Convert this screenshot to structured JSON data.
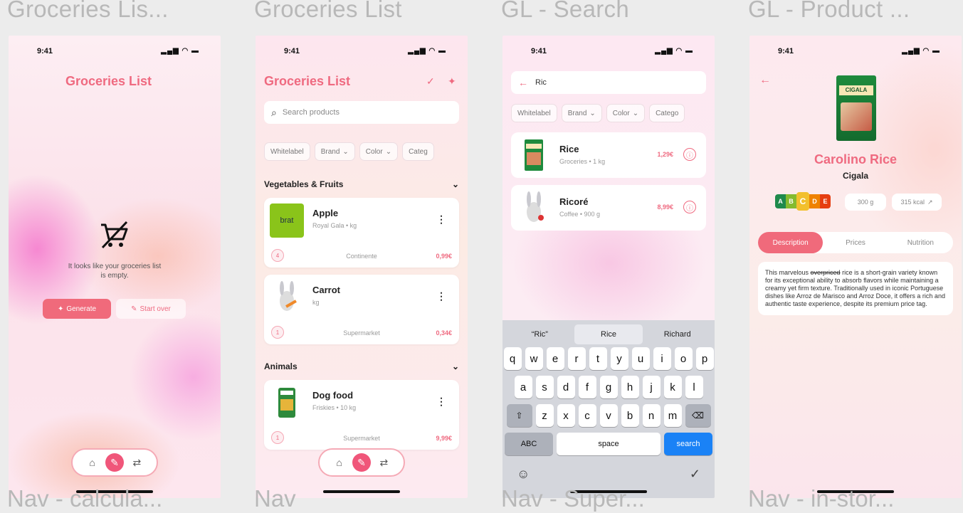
{
  "frame_titles": [
    "Groceries Lis...",
    "Groceries List",
    "GL - Search",
    "GL - Product ..."
  ],
  "frame_bottoms": [
    "Nav - calcula...",
    "Nav",
    "Nav - Super...",
    "Nav - in-stor..."
  ],
  "status": {
    "time": "9:41",
    "icons": "▂▄▆ ◠ ▬"
  },
  "icons": {
    "home": "⌂",
    "list": "✎",
    "swap": "⇄",
    "mic": "✓",
    "sparkle": "✦",
    "search": "⌕",
    "chevron": "⌄",
    "back": "←",
    "more": "⋮",
    "info": "ⓘ",
    "backspace": "⌫",
    "shift": "⇧",
    "emoji": "☺",
    "dictation": "✓",
    "external": "↗"
  },
  "empty_state": {
    "title": "Groceries List",
    "message": "It looks like your groceries list is empty.",
    "generate_label": "Generate",
    "start_over_label": "Start over"
  },
  "list_screen": {
    "title": "Groceries List",
    "search_placeholder": "Search products",
    "filters": [
      "Whitelabel",
      "Brand",
      "Color",
      "Categ"
    ],
    "sections": [
      {
        "title": "Vegetables & Fruits",
        "items": [
          {
            "name": "Apple",
            "sub": "Royal Gala • kg",
            "qty": "4",
            "store": "Continente",
            "price": "0,99€",
            "thumb_text": "brat"
          },
          {
            "name": "Carrot",
            "sub": "kg",
            "qty": "1",
            "store": "Supermarket",
            "price": "0,34€",
            "thumb_text": ""
          }
        ]
      },
      {
        "title": "Animals",
        "items": [
          {
            "name": "Dog food",
            "sub": "Friskies • 10 kg",
            "qty": "1",
            "store": "Supermarket",
            "price": "9,99€",
            "thumb_text": ""
          }
        ]
      }
    ]
  },
  "search_screen": {
    "query": "Ric",
    "filters": [
      "Whitelabel",
      "Brand",
      "Color",
      "Catego"
    ],
    "results": [
      {
        "name": "Rice",
        "sub": "Groceries • 1 kg",
        "price": "1,29€"
      },
      {
        "name": "Ricoré",
        "sub": "Coffee • 900 g",
        "price": "8,99€"
      }
    ],
    "suggestions": [
      "“Ric”",
      "Rice",
      "Richard"
    ],
    "keyboard": {
      "row1": [
        "q",
        "w",
        "e",
        "r",
        "t",
        "y",
        "u",
        "i",
        "o",
        "p"
      ],
      "row2": [
        "a",
        "s",
        "d",
        "f",
        "g",
        "h",
        "j",
        "k",
        "l"
      ],
      "row3": [
        "z",
        "x",
        "c",
        "v",
        "b",
        "n",
        "m"
      ],
      "abc": "ABC",
      "space": "space",
      "search": "search"
    }
  },
  "product_screen": {
    "package_label": "CIGALA",
    "name": "Carolino Rice",
    "brand": "Cigala",
    "nutri_grades": [
      "A",
      "B",
      "C",
      "D",
      "E"
    ],
    "nutri_selected": "C",
    "nutri_colors": [
      "#1f8a4c",
      "#85bb2f",
      "#f2c02e",
      "#ef8200",
      "#e63e11"
    ],
    "weight": "300 g",
    "energy": "315 kcal",
    "tabs": [
      "Description",
      "Prices",
      "Nutrition"
    ],
    "active_tab": "Description",
    "description_strike": "overpriced",
    "description_before": "This marvelous",
    "description_after": "rice is a short-grain variety known for its exceptional ability to absorb flavors while maintaining a creamy yet firm texture. Traditionally used in iconic Portuguese dishes like Arroz de Marisco and Arroz Doce, it offers a rich and authentic taste experience, despite its premium price tag."
  },
  "colors": {
    "accent": "#ef6a80",
    "search_key": "#1a82f6"
  }
}
